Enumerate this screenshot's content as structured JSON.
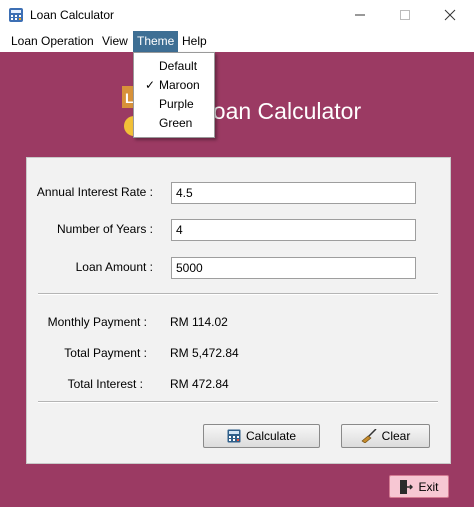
{
  "window": {
    "title": "Loan Calculator"
  },
  "menubar": {
    "items": [
      {
        "label": "Loan Operation"
      },
      {
        "label": "View"
      },
      {
        "label": "Theme"
      },
      {
        "label": "Help"
      }
    ]
  },
  "theme_menu": {
    "items": [
      {
        "label": "Default",
        "checked": false
      },
      {
        "label": "Maroon",
        "checked": true
      },
      {
        "label": "Purple",
        "checked": false
      },
      {
        "label": "Green",
        "checked": false
      }
    ],
    "check_mark": "✓"
  },
  "header": {
    "logo_title": "Loan Calculator",
    "logo_letter": "L"
  },
  "form": {
    "rate_label": "Annual Interest Rate :",
    "rate_value": "4.5",
    "years_label": "Number of Years :",
    "years_value": "4",
    "amount_label": "Loan Amount :",
    "amount_value": "5000"
  },
  "results": {
    "monthly_label": "Monthly Payment :",
    "monthly_value": "RM 114.02",
    "total_label": "Total Payment :",
    "total_value": "RM 5,472.84",
    "interest_label": "Total Interest :",
    "interest_value": "RM 472.84"
  },
  "buttons": {
    "calculate": "Calculate",
    "clear": "Clear",
    "exit": "Exit"
  },
  "colors": {
    "theme_bg": "#9b3a63",
    "menu_highlight": "#3e6f94",
    "exit_bg": "#f7c7d3"
  },
  "icons": {
    "app": "calculator-icon",
    "calculate": "calculator-icon",
    "clear": "broom-icon",
    "exit": "exit-door-icon"
  }
}
